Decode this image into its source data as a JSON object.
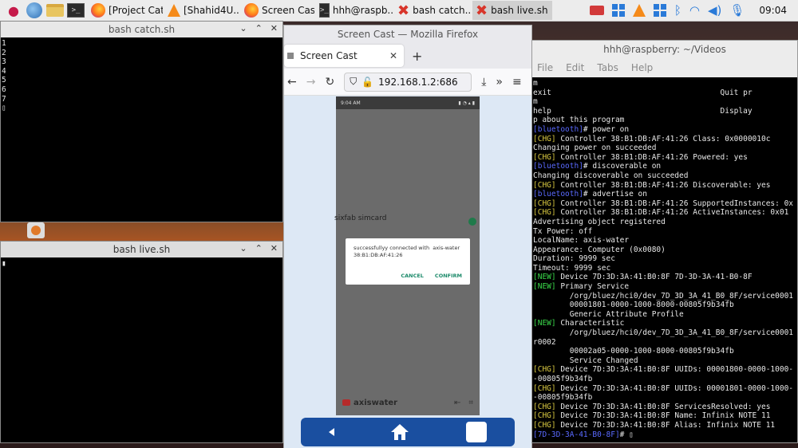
{
  "taskbar": {
    "tasks": [
      {
        "label": "[Project Cat..."
      },
      {
        "label": "[Shahid4U...."
      },
      {
        "label": "Screen Cas..."
      },
      {
        "label": "hhh@raspb..."
      },
      {
        "label": "bash catch...."
      },
      {
        "label": "bash live.sh"
      }
    ],
    "clock": "09:04"
  },
  "bash_catch": {
    "title": "bash catch.sh",
    "text": "1\n2\n3\n4\n5\n6\n7\n▯"
  },
  "bash_live": {
    "title": "bash live.sh",
    "text": "▮"
  },
  "firefox": {
    "window_title": "Screen Cast — Mozilla Firefox",
    "tab_label": "Screen Cast",
    "new_tab": "+",
    "url": "192.168.1.2:686"
  },
  "phone": {
    "status_time": "9:04 AM",
    "label_sim": "sixfab simcard",
    "dialog_text": "successfullyy connected with  axis-water\n38:B1:DB:AF:41:26",
    "cancel": "CANCEL",
    "confirm": "CONFIRM",
    "brand": "axiswater"
  },
  "terminal": {
    "title": "hhh@raspberry: ~/Videos",
    "menu": [
      "File",
      "Edit",
      "Tabs",
      "Help"
    ],
    "lines": [
      {
        "t": "m"
      },
      {
        "t": "exit                                     Quit pr"
      },
      {
        "t": "m"
      },
      {
        "t": "help                                     Display"
      },
      {
        "t": "p about this program"
      },
      {
        "p": "[bluetooth]",
        "t": "# power on"
      },
      {
        "p": "[CHG]",
        "t": " Controller 38:B1:DB:AF:41:26 Class: 0x0000010c"
      },
      {
        "t": "Changing power on succeeded"
      },
      {
        "p": "[CHG]",
        "t": " Controller 38:B1:DB:AF:41:26 Powered: yes"
      },
      {
        "p": "[bluetooth]",
        "t": "# discoverable on"
      },
      {
        "t": "Changing discoverable on succeeded"
      },
      {
        "p": "[CHG]",
        "t": " Controller 38:B1:DB:AF:41:26 Discoverable: yes"
      },
      {
        "p": "[bluetooth]",
        "t": "# advertise on"
      },
      {
        "p": "[CHG]",
        "t": " Controller 38:B1:DB:AF:41:26 SupportedInstances: 0x"
      },
      {
        "p": "[CHG]",
        "t": " Controller 38:B1:DB:AF:41:26 ActiveInstances: 0x01"
      },
      {
        "t": "Advertising object registered"
      },
      {
        "t": "Tx Power: off"
      },
      {
        "t": "LocalName: axis-water"
      },
      {
        "t": "Appearance: Computer (0x0080)"
      },
      {
        "t": "Duration: 9999 sec"
      },
      {
        "t": "Timeout: 9999 sec"
      },
      {
        "p": "[NEW]",
        "t": " Device 7D:3D:3A:41:B0:8F 7D-3D-3A-41-B0-8F"
      },
      {
        "p": "[NEW]",
        "t": " Primary Service"
      },
      {
        "t": "        /org/bluez/hci0/dev_7D_3D_3A_41_B0_8F/service0001"
      },
      {
        "t": "        00001801-0000-1000-8000-00805f9b34fb"
      },
      {
        "t": "        Generic Attribute Profile"
      },
      {
        "p": "[NEW]",
        "t": " Characteristic"
      },
      {
        "t": "        /org/bluez/hci0/dev_7D_3D_3A_41_B0_8F/service0001"
      },
      {
        "t": "r0002"
      },
      {
        "t": "        00002a05-0000-1000-8000-00805f9b34fb"
      },
      {
        "t": "        Service Changed"
      },
      {
        "p": "[CHG]",
        "t": " Device 7D:3D:3A:41:B0:8F UUIDs: 00001800-0000-1000-"
      },
      {
        "t": "-00805f9b34fb"
      },
      {
        "p": "[CHG]",
        "t": " Device 7D:3D:3A:41:B0:8F UUIDs: 00001801-0000-1000-"
      },
      {
        "t": "-00805f9b34fb"
      },
      {
        "p": "[CHG]",
        "t": " Device 7D:3D:3A:41:B0:8F ServicesResolved: yes"
      },
      {
        "p": "[CHG]",
        "t": " Device 7D:3D:3A:41:B0:8F Name: Infinix NOTE 11"
      },
      {
        "p": "[CHG]",
        "t": " Device 7D:3D:3A:41:B0:8F Alias: Infinix NOTE 11"
      }
    ],
    "prompt": "[7D-3D-3A-41-B0-8F]",
    "prompt_suffix": "# ",
    "colors": {
      "bluetooth": "#5a6aff",
      "chg": "#d8c840",
      "new": "#3ad84a",
      "prompt": "#5a6aff"
    }
  }
}
